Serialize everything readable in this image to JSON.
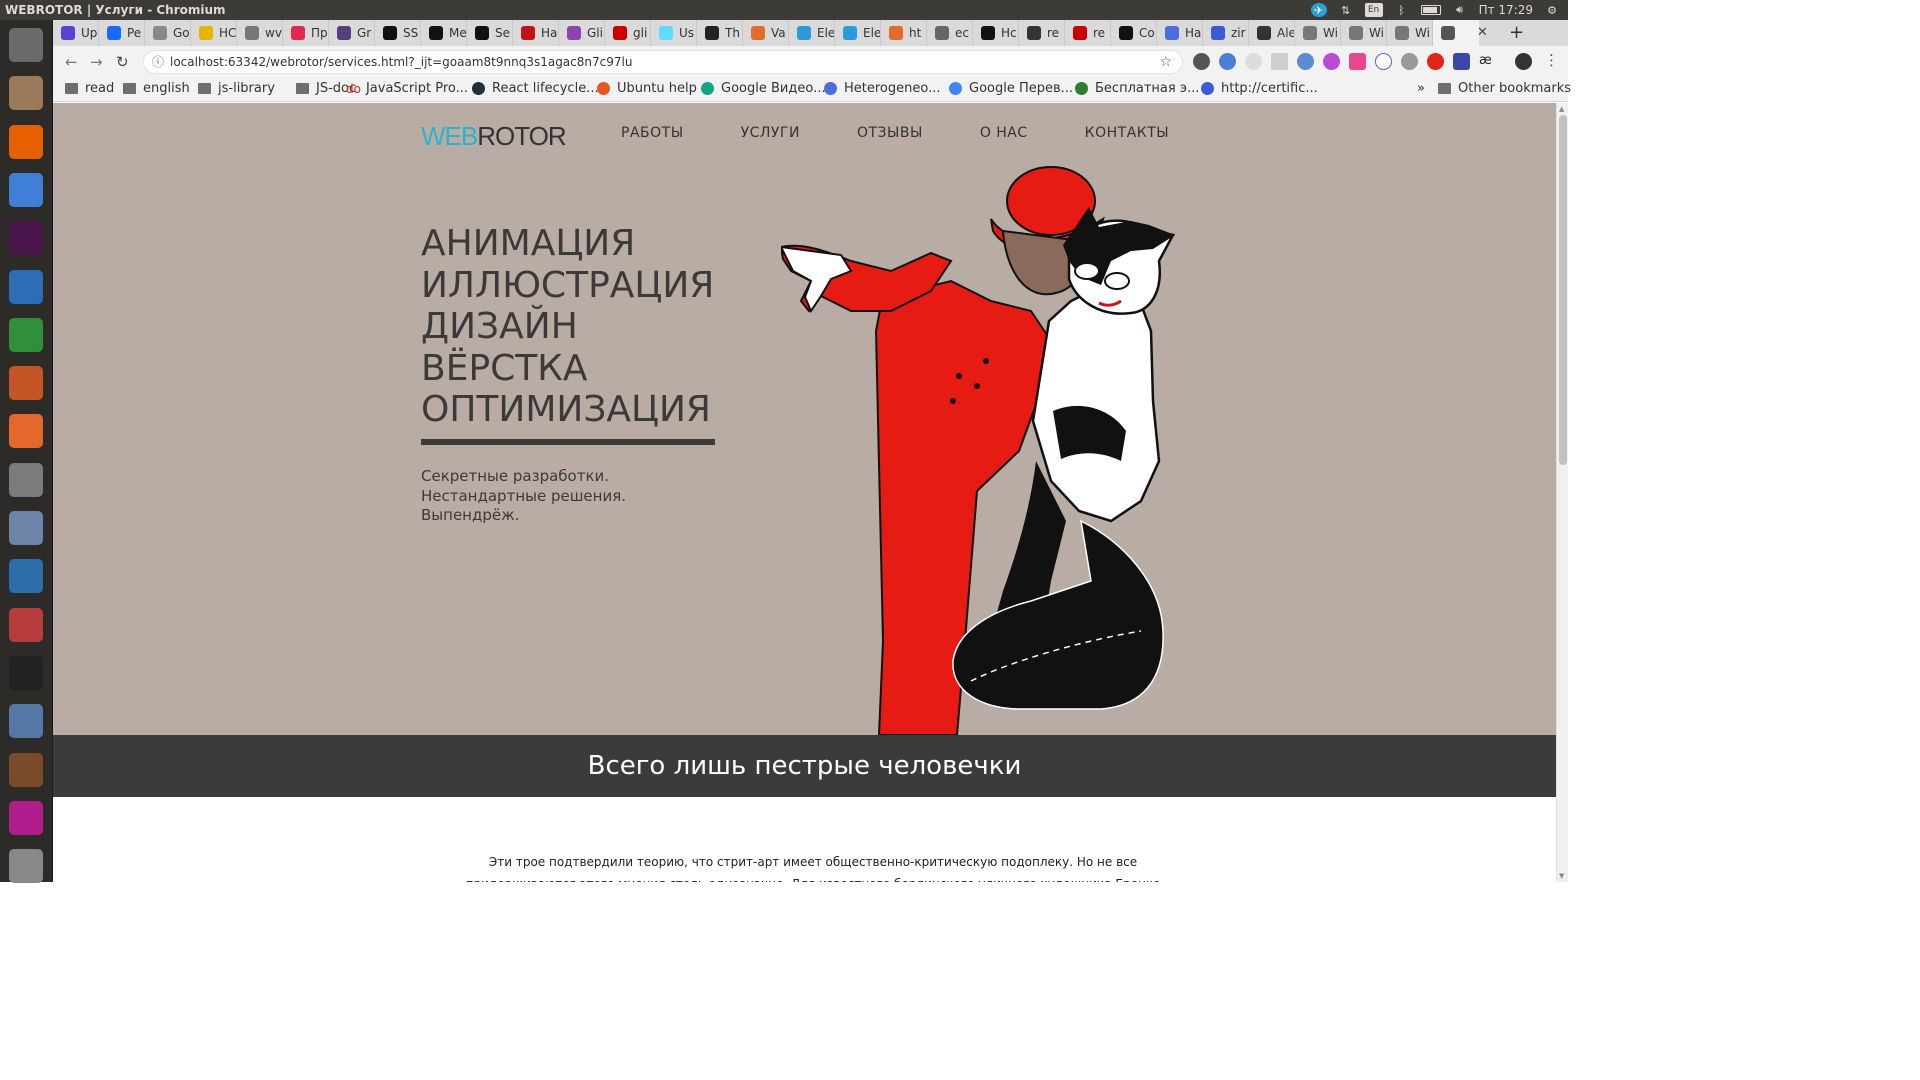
{
  "os": {
    "window_title": "WEBROTOR | Услуги - Chromium",
    "clock": "Пт 17:29",
    "keyboard_layout": "En",
    "launcher_apps": [
      {
        "name": "ubuntu-home-icon",
        "color": "#6a6a6a"
      },
      {
        "name": "files-icon",
        "color": "#9a7a5a"
      },
      {
        "name": "firefox-icon",
        "color": "#e66000"
      },
      {
        "name": "chromium-icon",
        "color": "#3f7fd8"
      },
      {
        "name": "slack-icon",
        "color": "#4a154b"
      },
      {
        "name": "libreoffice-writer-icon",
        "color": "#2d6db5"
      },
      {
        "name": "libreoffice-calc-icon",
        "color": "#2f8f3a"
      },
      {
        "name": "libreoffice-impress-icon",
        "color": "#c55527"
      },
      {
        "name": "software-center-icon",
        "color": "#e2692b"
      },
      {
        "name": "system-settings-icon",
        "color": "#7b7b7b"
      },
      {
        "name": "text-editor-icon",
        "color": "#6c85a8"
      },
      {
        "name": "system-monitor-icon",
        "color": "#2b6ea8"
      },
      {
        "name": "installer-icon",
        "color": "#b93c3c"
      },
      {
        "name": "amazon-icon",
        "color": "#222222"
      },
      {
        "name": "thermometer-icon",
        "color": "#5678a6"
      },
      {
        "name": "library-icon",
        "color": "#7a4a2a"
      },
      {
        "name": "phpstorm-icon",
        "color": "#b01d8d"
      },
      {
        "name": "scanner-icon",
        "color": "#888888"
      }
    ]
  },
  "browser": {
    "tabs": [
      {
        "label": "Up",
        "color": "#5d3fd3"
      },
      {
        "label": "Pe",
        "color": "#1769ff"
      },
      {
        "label": "Go",
        "color": "#888888"
      },
      {
        "label": "HC",
        "color": "#e5b600"
      },
      {
        "label": "wv",
        "color": "#777777"
      },
      {
        "label": "Пр",
        "color": "#e2264d"
      },
      {
        "label": "Gr",
        "color": "#563d7c"
      },
      {
        "label": "SS",
        "color": "#111111"
      },
      {
        "label": "Me",
        "color": "#111111"
      },
      {
        "label": "Se",
        "color": "#111111"
      },
      {
        "label": "Ha",
        "color": "#c2151b"
      },
      {
        "label": "Gli",
        "color": "#8e44ad"
      },
      {
        "label": "gli",
        "color": "#cc0000"
      },
      {
        "label": "Us",
        "color": "#61dafb"
      },
      {
        "label": "Th",
        "color": "#222222"
      },
      {
        "label": "Va",
        "color": "#e06b2a"
      },
      {
        "label": "Ele",
        "color": "#2c9ad9"
      },
      {
        "label": "Ele",
        "color": "#2c9ad9"
      },
      {
        "label": "ht",
        "color": "#e06b2a"
      },
      {
        "label": "ec",
        "color": "#666666"
      },
      {
        "label": "Hc",
        "color": "#111111"
      },
      {
        "label": "re",
        "color": "#333333"
      },
      {
        "label": "re",
        "color": "#cc0000"
      },
      {
        "label": "Co",
        "color": "#111111"
      },
      {
        "label": "Ha",
        "color": "#4a6ee0"
      },
      {
        "label": "zir",
        "color": "#3a5bd9"
      },
      {
        "label": "Ale",
        "color": "#333333"
      },
      {
        "label": "Wi",
        "color": "#777777"
      },
      {
        "label": "Wi",
        "color": "#777777"
      },
      {
        "label": "Wi",
        "color": "#777777"
      }
    ],
    "url": "localhost:63342/webrotor/services.html?_ijt=goaam8t9nnq3s1agac8n7c97lu",
    "bookmarks": [
      {
        "label": "read",
        "type": "folder"
      },
      {
        "label": "english",
        "type": "folder"
      },
      {
        "label": "js-library",
        "type": "folder"
      },
      {
        "label": "JS-doc",
        "type": "folder"
      },
      {
        "label": "JavaScript Pro...",
        "type": "site",
        "icon": "do",
        "color": "#d52b1e"
      },
      {
        "label": "React lifecycle...",
        "type": "site",
        "color": "#1f2d3d"
      },
      {
        "label": "Ubuntu help",
        "type": "site",
        "color": "#e95420"
      },
      {
        "label": "Google Видео...",
        "type": "site",
        "color": "#11a683"
      },
      {
        "label": "Heterogeneo...",
        "type": "site",
        "color": "#4a6ee0"
      },
      {
        "label": "Google Перев...",
        "type": "site",
        "color": "#4285f4"
      },
      {
        "label": "Бесплатная э...",
        "type": "site",
        "color": "#2e7d32"
      },
      {
        "label": "http://certific...",
        "type": "site",
        "color": "#3b5bdb"
      }
    ],
    "overflow_chevron": "»",
    "other_bookmarks": "Other bookmarks"
  },
  "site": {
    "logo_web": "WEB",
    "logo_rotor": "ROTOR",
    "nav": [
      "РАБОТЫ",
      "УСЛУГИ",
      "ОТЗЫВЫ",
      "О НАС",
      "КОНТАКТЫ"
    ],
    "services": [
      "АНИМАЦИЯ",
      "ИЛЛЮСТРАЦИЯ",
      "ДИЗАЙН",
      "ВЁРСТКА",
      "ОПТИМИЗАЦИЯ"
    ],
    "tagline": [
      "Секретные разработки.",
      "Нестандартные решения.",
      "Выпендрёж."
    ],
    "band_title": "Всего лишь пестрые человечки",
    "body_line_1": "Эти трое подтвердили теорию, что стрит-арт имеет общественно-критическую подоплеку. Но не все",
    "body_line_2": "придерживаются этого мнения столь однозначно. Для известного берлинского уличного художника Еренко"
  }
}
